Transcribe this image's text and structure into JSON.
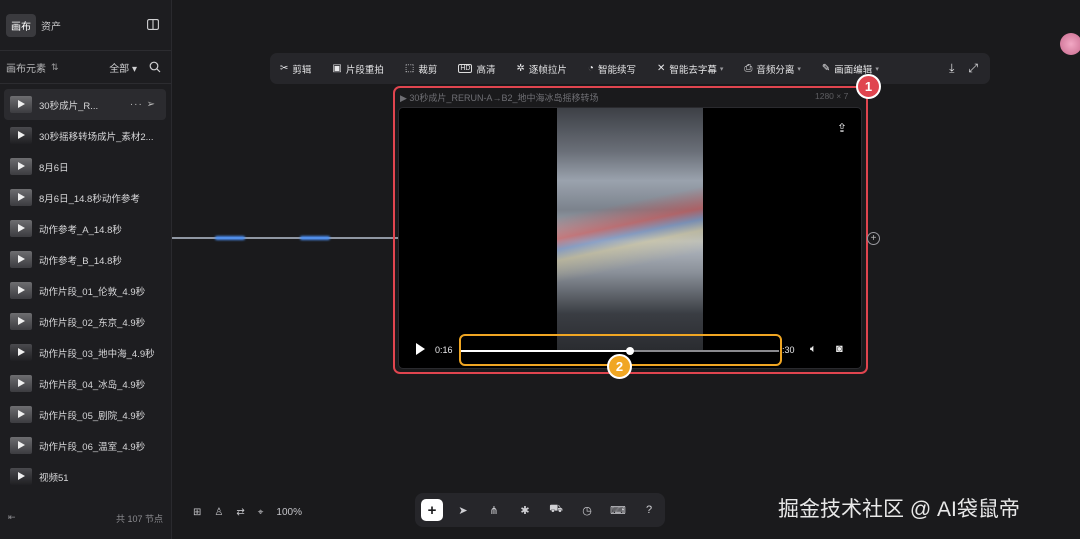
{
  "sidebar": {
    "tabs": [
      {
        "label": "画布",
        "active": true
      },
      {
        "label": "资产",
        "active": false
      }
    ],
    "filter_label": "画布元素",
    "filter_all": "全部",
    "items": [
      {
        "label": "30秒成片_R...",
        "selected": true,
        "actions": "···"
      },
      {
        "label": "30秒摇移转场成片_素材2..."
      },
      {
        "label": "8月6日"
      },
      {
        "label": "8月6日_14.8秒动作参考"
      },
      {
        "label": "动作参考_A_14.8秒"
      },
      {
        "label": "动作参考_B_14.8秒"
      },
      {
        "label": "动作片段_01_伦敦_4.9秒"
      },
      {
        "label": "动作片段_02_东京_4.9秒"
      },
      {
        "label": "动作片段_03_地中海_4.9秒"
      },
      {
        "label": "动作片段_04_冰岛_4.9秒"
      },
      {
        "label": "动作片段_05_剧院_4.9秒"
      },
      {
        "label": "动作片段_06_温室_4.9秒"
      },
      {
        "label": "视频51"
      }
    ],
    "total_nodes": "共 107 节点"
  },
  "toolbar": {
    "tools": [
      {
        "icon": "scissors-icon",
        "glyph": "✂",
        "label": "剪辑"
      },
      {
        "icon": "segment-icon",
        "glyph": "▣",
        "label": "片段重拍"
      },
      {
        "icon": "crop-icon",
        "glyph": "⬚",
        "label": "裁剪"
      },
      {
        "icon": "hd-icon",
        "glyph": "HD",
        "label": "高清"
      },
      {
        "icon": "frame-icon",
        "glyph": "✲",
        "label": "逐帧拉片"
      },
      {
        "icon": "continue-icon",
        "glyph": "◔",
        "label": "智能续写"
      },
      {
        "icon": "subtitle-icon",
        "glyph": "✕",
        "label": "智能去字幕",
        "caret": true
      },
      {
        "icon": "audio-icon",
        "glyph": "⎙",
        "label": "音频分离",
        "caret": true
      },
      {
        "icon": "edit-icon",
        "glyph": "✎",
        "label": "画面编辑",
        "caret": true
      }
    ]
  },
  "node": {
    "title": "30秒成片_RERUN-A→B2_地中海冰岛摇移转场",
    "resolution": "1280 × 7",
    "current_time": "0:16",
    "end_time": ":30",
    "progress": 0.53
  },
  "badges": {
    "one": "1",
    "two": "2"
  },
  "bottom": {
    "zoom": "100%",
    "watermark": "掘金技术社区 @ AI袋鼠帝"
  },
  "colors": {
    "highlight_red": "#e0454f",
    "highlight_orange": "#f0a623",
    "connector_blue": "#4b8ef0"
  }
}
